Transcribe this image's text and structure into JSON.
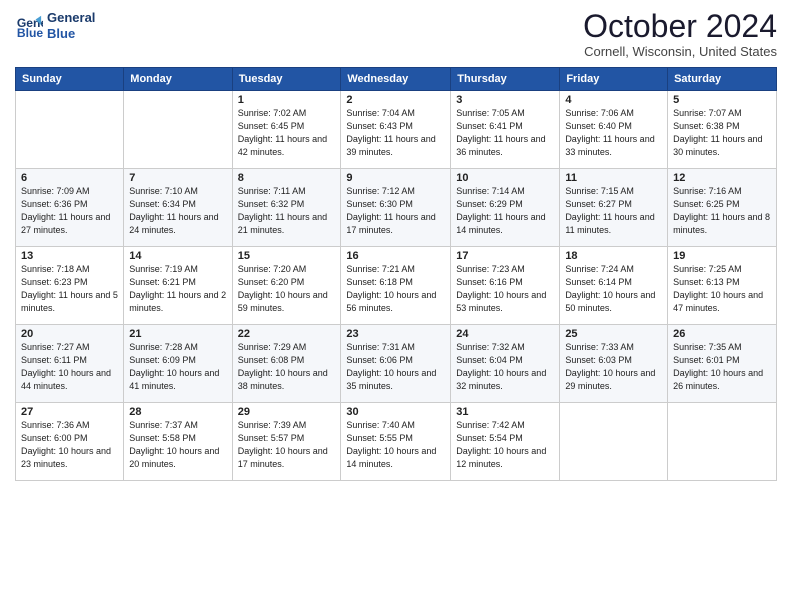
{
  "logo": {
    "line1": "General",
    "line2": "Blue"
  },
  "title": "October 2024",
  "location": "Cornell, Wisconsin, United States",
  "days_of_week": [
    "Sunday",
    "Monday",
    "Tuesday",
    "Wednesday",
    "Thursday",
    "Friday",
    "Saturday"
  ],
  "weeks": [
    [
      {
        "day": "",
        "sunrise": "",
        "sunset": "",
        "daylight": ""
      },
      {
        "day": "",
        "sunrise": "",
        "sunset": "",
        "daylight": ""
      },
      {
        "day": "1",
        "sunrise": "Sunrise: 7:02 AM",
        "sunset": "Sunset: 6:45 PM",
        "daylight": "Daylight: 11 hours and 42 minutes."
      },
      {
        "day": "2",
        "sunrise": "Sunrise: 7:04 AM",
        "sunset": "Sunset: 6:43 PM",
        "daylight": "Daylight: 11 hours and 39 minutes."
      },
      {
        "day": "3",
        "sunrise": "Sunrise: 7:05 AM",
        "sunset": "Sunset: 6:41 PM",
        "daylight": "Daylight: 11 hours and 36 minutes."
      },
      {
        "day": "4",
        "sunrise": "Sunrise: 7:06 AM",
        "sunset": "Sunset: 6:40 PM",
        "daylight": "Daylight: 11 hours and 33 minutes."
      },
      {
        "day": "5",
        "sunrise": "Sunrise: 7:07 AM",
        "sunset": "Sunset: 6:38 PM",
        "daylight": "Daylight: 11 hours and 30 minutes."
      }
    ],
    [
      {
        "day": "6",
        "sunrise": "Sunrise: 7:09 AM",
        "sunset": "Sunset: 6:36 PM",
        "daylight": "Daylight: 11 hours and 27 minutes."
      },
      {
        "day": "7",
        "sunrise": "Sunrise: 7:10 AM",
        "sunset": "Sunset: 6:34 PM",
        "daylight": "Daylight: 11 hours and 24 minutes."
      },
      {
        "day": "8",
        "sunrise": "Sunrise: 7:11 AM",
        "sunset": "Sunset: 6:32 PM",
        "daylight": "Daylight: 11 hours and 21 minutes."
      },
      {
        "day": "9",
        "sunrise": "Sunrise: 7:12 AM",
        "sunset": "Sunset: 6:30 PM",
        "daylight": "Daylight: 11 hours and 17 minutes."
      },
      {
        "day": "10",
        "sunrise": "Sunrise: 7:14 AM",
        "sunset": "Sunset: 6:29 PM",
        "daylight": "Daylight: 11 hours and 14 minutes."
      },
      {
        "day": "11",
        "sunrise": "Sunrise: 7:15 AM",
        "sunset": "Sunset: 6:27 PM",
        "daylight": "Daylight: 11 hours and 11 minutes."
      },
      {
        "day": "12",
        "sunrise": "Sunrise: 7:16 AM",
        "sunset": "Sunset: 6:25 PM",
        "daylight": "Daylight: 11 hours and 8 minutes."
      }
    ],
    [
      {
        "day": "13",
        "sunrise": "Sunrise: 7:18 AM",
        "sunset": "Sunset: 6:23 PM",
        "daylight": "Daylight: 11 hours and 5 minutes."
      },
      {
        "day": "14",
        "sunrise": "Sunrise: 7:19 AM",
        "sunset": "Sunset: 6:21 PM",
        "daylight": "Daylight: 11 hours and 2 minutes."
      },
      {
        "day": "15",
        "sunrise": "Sunrise: 7:20 AM",
        "sunset": "Sunset: 6:20 PM",
        "daylight": "Daylight: 10 hours and 59 minutes."
      },
      {
        "day": "16",
        "sunrise": "Sunrise: 7:21 AM",
        "sunset": "Sunset: 6:18 PM",
        "daylight": "Daylight: 10 hours and 56 minutes."
      },
      {
        "day": "17",
        "sunrise": "Sunrise: 7:23 AM",
        "sunset": "Sunset: 6:16 PM",
        "daylight": "Daylight: 10 hours and 53 minutes."
      },
      {
        "day": "18",
        "sunrise": "Sunrise: 7:24 AM",
        "sunset": "Sunset: 6:14 PM",
        "daylight": "Daylight: 10 hours and 50 minutes."
      },
      {
        "day": "19",
        "sunrise": "Sunrise: 7:25 AM",
        "sunset": "Sunset: 6:13 PM",
        "daylight": "Daylight: 10 hours and 47 minutes."
      }
    ],
    [
      {
        "day": "20",
        "sunrise": "Sunrise: 7:27 AM",
        "sunset": "Sunset: 6:11 PM",
        "daylight": "Daylight: 10 hours and 44 minutes."
      },
      {
        "day": "21",
        "sunrise": "Sunrise: 7:28 AM",
        "sunset": "Sunset: 6:09 PM",
        "daylight": "Daylight: 10 hours and 41 minutes."
      },
      {
        "day": "22",
        "sunrise": "Sunrise: 7:29 AM",
        "sunset": "Sunset: 6:08 PM",
        "daylight": "Daylight: 10 hours and 38 minutes."
      },
      {
        "day": "23",
        "sunrise": "Sunrise: 7:31 AM",
        "sunset": "Sunset: 6:06 PM",
        "daylight": "Daylight: 10 hours and 35 minutes."
      },
      {
        "day": "24",
        "sunrise": "Sunrise: 7:32 AM",
        "sunset": "Sunset: 6:04 PM",
        "daylight": "Daylight: 10 hours and 32 minutes."
      },
      {
        "day": "25",
        "sunrise": "Sunrise: 7:33 AM",
        "sunset": "Sunset: 6:03 PM",
        "daylight": "Daylight: 10 hours and 29 minutes."
      },
      {
        "day": "26",
        "sunrise": "Sunrise: 7:35 AM",
        "sunset": "Sunset: 6:01 PM",
        "daylight": "Daylight: 10 hours and 26 minutes."
      }
    ],
    [
      {
        "day": "27",
        "sunrise": "Sunrise: 7:36 AM",
        "sunset": "Sunset: 6:00 PM",
        "daylight": "Daylight: 10 hours and 23 minutes."
      },
      {
        "day": "28",
        "sunrise": "Sunrise: 7:37 AM",
        "sunset": "Sunset: 5:58 PM",
        "daylight": "Daylight: 10 hours and 20 minutes."
      },
      {
        "day": "29",
        "sunrise": "Sunrise: 7:39 AM",
        "sunset": "Sunset: 5:57 PM",
        "daylight": "Daylight: 10 hours and 17 minutes."
      },
      {
        "day": "30",
        "sunrise": "Sunrise: 7:40 AM",
        "sunset": "Sunset: 5:55 PM",
        "daylight": "Daylight: 10 hours and 14 minutes."
      },
      {
        "day": "31",
        "sunrise": "Sunrise: 7:42 AM",
        "sunset": "Sunset: 5:54 PM",
        "daylight": "Daylight: 10 hours and 12 minutes."
      },
      {
        "day": "",
        "sunrise": "",
        "sunset": "",
        "daylight": ""
      },
      {
        "day": "",
        "sunrise": "",
        "sunset": "",
        "daylight": ""
      }
    ]
  ]
}
